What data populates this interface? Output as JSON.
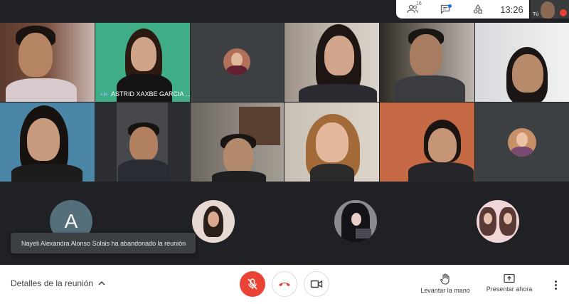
{
  "topbar": {
    "participants_count": "16",
    "time": "13:26",
    "self_label": "Tú"
  },
  "tiles": {
    "speaker_name": "ASTRID XAXBE GARCIA ..."
  },
  "avatars": {
    "letter": "A"
  },
  "toast": {
    "message": "Nayeli Alexandra Alonso Solais ha abandonado la reunión"
  },
  "bottombar": {
    "details_label": "Detalles de la reunión",
    "raise_hand_label": "Levantar la mano",
    "present_label": "Presentar ahora"
  },
  "icons": {
    "participants": "people-icon",
    "chat": "chat-icon",
    "activities": "shapes-icon",
    "mic_off": "mic-off-icon",
    "hangup": "phone-hangup-icon",
    "camera": "videocam-icon",
    "raise_hand": "hand-icon",
    "present": "present-screen-icon",
    "more": "more-vert-icon"
  },
  "colors": {
    "stage_bg": "#202124",
    "accent_blue": "#8ab4f8",
    "danger_red": "#ea4335"
  }
}
